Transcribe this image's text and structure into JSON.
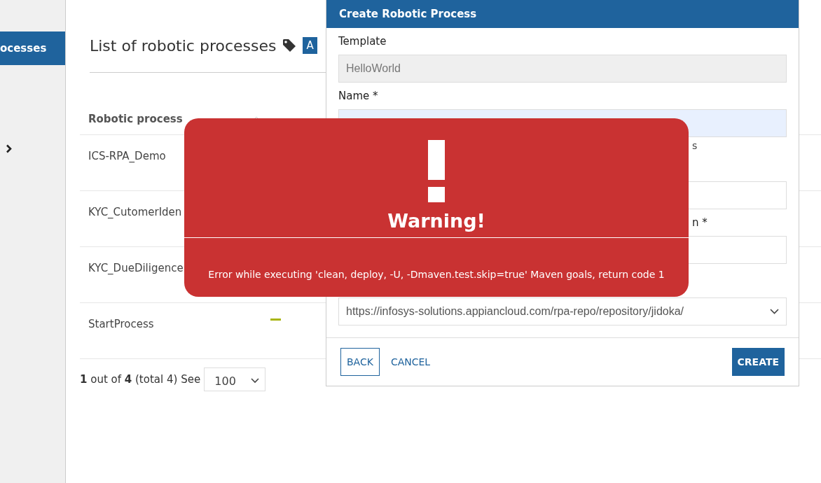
{
  "sidebar": {
    "items": [
      {
        "label": "ocesses",
        "selected": true
      }
    ]
  },
  "page": {
    "title": "List of robotic processes",
    "badge": "A"
  },
  "table": {
    "columns": [
      "Robotic process"
    ],
    "rows": [
      {
        "name": "ICS-RPA_Demo"
      },
      {
        "name": "KYC_CutomerIden"
      },
      {
        "name": "KYC_DueDiligence"
      },
      {
        "name": "StartProcess",
        "flagged": true
      }
    ]
  },
  "pagination": {
    "current": "1",
    "pages": "4",
    "total_text": "(total 4)",
    "of_text": "out of",
    "see_label": "See",
    "page_size": "100"
  },
  "dialog": {
    "title": "Create Robotic Process",
    "fields": [
      {
        "label": "Template",
        "value": "HelloWorld",
        "kind": "readonly"
      },
      {
        "label": "Name *",
        "kind": "focused",
        "hint": "s"
      },
      {
        "kind": "text"
      },
      {
        "label": "n *",
        "kind": "text"
      },
      {
        "value": "https://infosys-solutions.appiancloud.com/rpa-repo/repository/jidoka/",
        "kind": "select"
      }
    ],
    "buttons": [
      {
        "label": "BACK",
        "kind": "outline"
      },
      {
        "label": "CANCEL",
        "kind": "link"
      },
      {
        "label": "CREATE",
        "kind": "primary"
      }
    ]
  },
  "warning": {
    "title": "Warning!",
    "message": "Error while executing 'clean, deploy, -U, -Dmaven.test.skip=true' Maven goals, return code 1"
  }
}
